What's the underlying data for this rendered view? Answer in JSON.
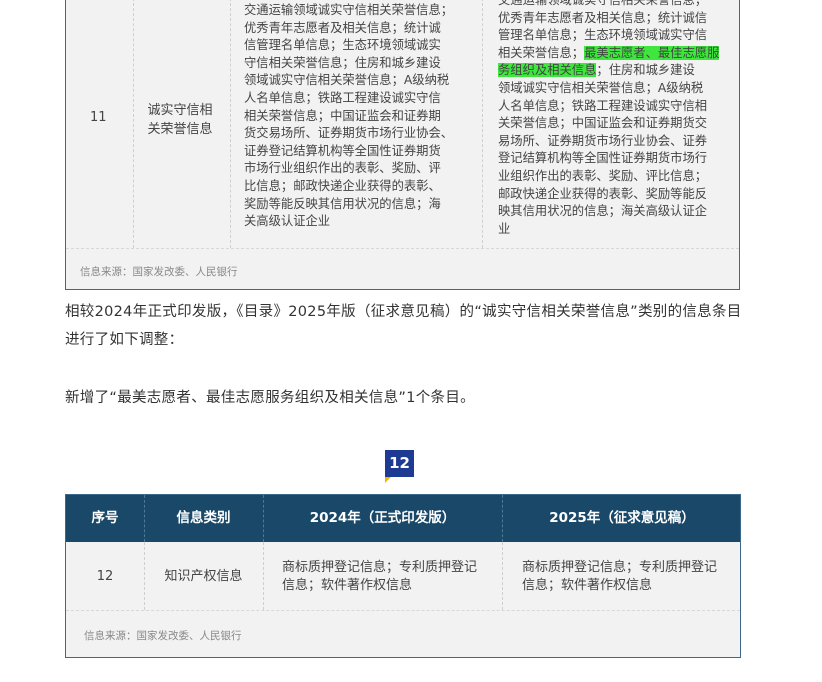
{
  "table1": {
    "row_number": "11",
    "category": "诚实守信相关荣誉信息",
    "col_2024_lines": [
      "交通运输领域诚实守信相关荣誉信息；",
      "优秀青年志愿者及相关信息；统计诚",
      "信管理名单信息；生态环境领域诚实",
      "守信相关荣誉信息；住房和城乡建设",
      "领域诚实守信相关荣誉信息；A级纳税",
      "人名单信息；铁路工程建设诚实守信",
      "相关荣誉信息；中国证监会和证券期",
      "货交易场所、证券期货市场行业协会、",
      "证券登记结算机构等全国性证券期货",
      "市场行业组织作出的表彰、奖励、评",
      "比信息；邮政快递企业获得的表彰、",
      "奖励等能反映其信用状况的信息；海",
      "关高级认证企业"
    ],
    "col_2025_pre": "交通运输领域诚实守信相关荣誉信息；\n优秀青年志愿者及相关信息；统计诚信\n管理名单信息；生态环境领域诚实守信\n相关荣誉信息；",
    "col_2025_highlight": "最美志愿者、最佳志愿服务组织及相关信息",
    "col_2025_post": "；住房和城乡建设\n领域诚实守信相关荣誉信息；A级纳税\n人名单信息；铁路工程建设诚实守信相\n关荣誉信息；中国证监会和证券期货交\n易场所、证券期货市场行业协会、证券\n登记结算机构等全国性证券期货市场行\n业组织作出的表彰、奖励、评比信息；\n邮政快递企业获得的表彰、奖励等能反\n映其信用状况的信息；海关高级认证企\n业",
    "source": "信息来源：国家发改委、人民银行"
  },
  "paragraph1": "相较2024年正式印发版，《目录》2025年版（征求意见稿）的“诚实守信相关荣誉信息”类别的信息条目进行了如下调整：",
  "paragraph2": "新增了“最美志愿者、最佳志愿服务组织及相关信息”1个条目。",
  "badge": "12",
  "table2": {
    "headers": [
      "序号",
      "信息类别",
      "2024年（正式印发版）",
      "2025年（征求意见稿）"
    ],
    "row": {
      "number": "12",
      "category": "知识产权信息",
      "col_2024": "商标质押登记信息；专利质押登记信息；软件著作权信息",
      "col_2025": "商标质押登记信息；专利质押登记信息；软件著作权信息"
    },
    "source": "信息来源：国家发改委、人民银行"
  },
  "colors": {
    "header_bg": "#1a4868",
    "border": "#3d6a8a",
    "highlight": "#3ee63e",
    "badge_bg": "#1e3b93",
    "badge_accent": "#f4b400"
  }
}
